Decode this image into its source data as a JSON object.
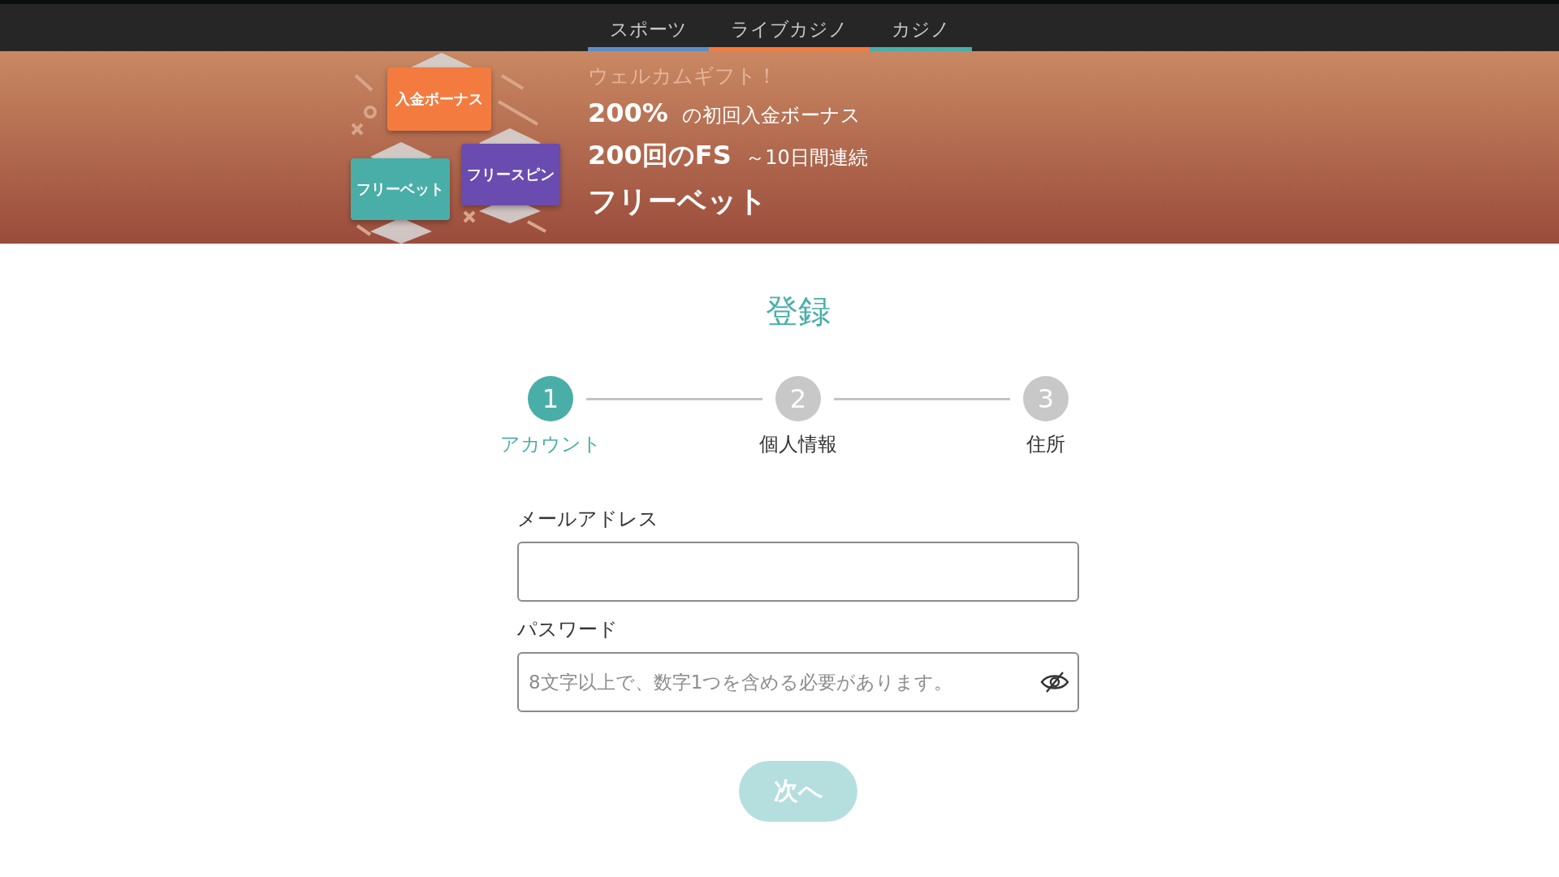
{
  "nav": {
    "tabs": [
      {
        "label": "スポーツ",
        "color": "#5b8fc6"
      },
      {
        "label": "ライブカジノ",
        "color": "#f47b3f"
      },
      {
        "label": "カジノ",
        "color": "#4aaea8"
      }
    ]
  },
  "banner": {
    "tags": [
      {
        "label": "入金ボーナス",
        "color": "#f47b3f"
      },
      {
        "label": "フリーベット",
        "color": "#4aaea8"
      },
      {
        "label": "フリースピン",
        "color": "#6a4bb0"
      }
    ],
    "kicker": "ウェルカムギフト！",
    "lines": [
      "**200%** の初回入金ボーナス",
      "**200回のFS** ～10日間連続"
    ],
    "headline": "フリーベット"
  },
  "title": "登録",
  "steps": [
    {
      "number": "1",
      "label": "アカウント",
      "selected": true
    },
    {
      "number": "2",
      "label": "個人情報",
      "selected": false
    },
    {
      "number": "3",
      "label": "住所",
      "selected": false
    }
  ],
  "fields": [
    {
      "label": "メールアドレス",
      "kind": "email"
    },
    {
      "label": "パスワード",
      "kind": "password",
      "placeholder": "8文字以上で、数字1つを含める必要があります。"
    }
  ],
  "next_button": {
    "label": "次へ",
    "disabled": true
  }
}
